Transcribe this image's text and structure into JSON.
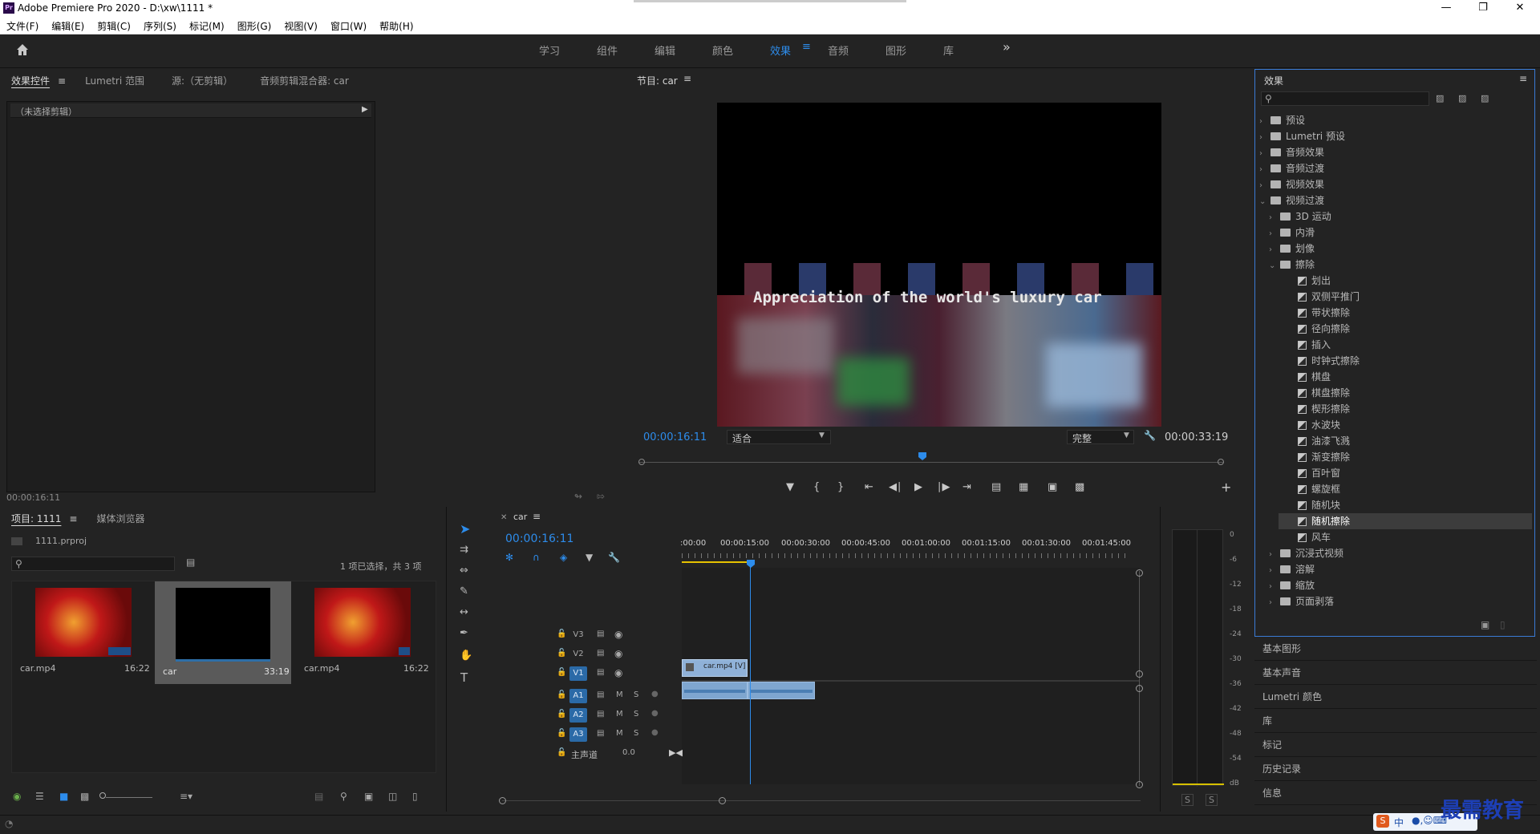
{
  "app": {
    "title": "Adobe Premiere Pro 2020 - D:\\xw\\1111 *",
    "logo_text": "Pr",
    "window_controls": [
      "minimize-icon",
      "maximize-icon",
      "close-icon"
    ]
  },
  "menu": [
    "文件(F)",
    "编辑(E)",
    "剪辑(C)",
    "序列(S)",
    "标记(M)",
    "图形(G)",
    "视图(V)",
    "窗口(W)",
    "帮助(H)"
  ],
  "workspaces": {
    "items": [
      "学习",
      "组件",
      "编辑",
      "颜色",
      "效果",
      "音频",
      "图形",
      "库"
    ],
    "active": "效果",
    "more": "»"
  },
  "source_panel": {
    "tabs": [
      "效果控件",
      "Lumetri 范围",
      "源:（无剪辑）",
      "音频剪辑混合器: car"
    ],
    "no_clip": "（未选择剪辑）",
    "timecode": "00:00:16:11"
  },
  "program": {
    "title": "节目: car",
    "overlay_text": "Appreciation of the world's luxury car",
    "timecode_current": "00:00:16:11",
    "fit": "适合",
    "quality": "完整",
    "timecode_total": "00:00:33:19",
    "playhead_fraction": 0.485
  },
  "project": {
    "tabs": [
      "项目: 1111",
      "媒体浏览器"
    ],
    "file": "1111.prproj",
    "selection": "1 项已选择，共 3 项",
    "items": [
      {
        "name": "car.mp4",
        "duration": "16:22",
        "kind": "video"
      },
      {
        "name": "car",
        "duration": "33:19",
        "kind": "sequence"
      },
      {
        "name": "car.mp4",
        "duration": "16:22",
        "kind": "video"
      }
    ]
  },
  "timeline": {
    "tab": "car",
    "timecode": "00:00:16:11",
    "ruler": [
      ":00:00",
      "00:00:15:00",
      "00:00:30:00",
      "00:00:45:00",
      "00:01:00:00",
      "00:01:15:00",
      "00:01:30:00",
      "00:01:45:00"
    ],
    "video_tracks": [
      "V3",
      "V2",
      "V1"
    ],
    "audio_tracks": [
      "A1",
      "A2",
      "A3"
    ],
    "master_label": "主声道",
    "master_value": "0.0",
    "clip_label": "car.mp4 [V]",
    "track_buttons": {
      "m": "M",
      "s": "S"
    }
  },
  "meter": {
    "scale": [
      "0",
      "-6",
      "-12",
      "-18",
      "-24",
      "-30",
      "-36",
      "-42",
      "-48",
      "-54",
      "dB"
    ],
    "solo": [
      "S",
      "S"
    ]
  },
  "effects": {
    "title": "效果",
    "tree": [
      {
        "label": "预设",
        "level": 0,
        "type": "folder",
        "expanded": false
      },
      {
        "label": "Lumetri 预设",
        "level": 0,
        "type": "folder",
        "expanded": false
      },
      {
        "label": "音频效果",
        "level": 0,
        "type": "folder",
        "expanded": false
      },
      {
        "label": "音频过渡",
        "level": 0,
        "type": "folder",
        "expanded": false
      },
      {
        "label": "视频效果",
        "level": 0,
        "type": "folder",
        "expanded": false
      },
      {
        "label": "视频过渡",
        "level": 0,
        "type": "folder",
        "expanded": true
      },
      {
        "label": "3D 运动",
        "level": 1,
        "type": "folder",
        "expanded": false
      },
      {
        "label": "内滑",
        "level": 1,
        "type": "folder",
        "expanded": false
      },
      {
        "label": "划像",
        "level": 1,
        "type": "folder",
        "expanded": false
      },
      {
        "label": "擦除",
        "level": 1,
        "type": "folder",
        "expanded": true
      },
      {
        "label": "划出",
        "level": 2,
        "type": "fx"
      },
      {
        "label": "双侧平推门",
        "level": 2,
        "type": "fx"
      },
      {
        "label": "带状擦除",
        "level": 2,
        "type": "fx"
      },
      {
        "label": "径向擦除",
        "level": 2,
        "type": "fx"
      },
      {
        "label": "插入",
        "level": 2,
        "type": "fx"
      },
      {
        "label": "时钟式擦除",
        "level": 2,
        "type": "fx"
      },
      {
        "label": "棋盘",
        "level": 2,
        "type": "fx"
      },
      {
        "label": "棋盘擦除",
        "level": 2,
        "type": "fx"
      },
      {
        "label": "楔形擦除",
        "level": 2,
        "type": "fx"
      },
      {
        "label": "水波块",
        "level": 2,
        "type": "fx"
      },
      {
        "label": "油漆飞溅",
        "level": 2,
        "type": "fx"
      },
      {
        "label": "渐变擦除",
        "level": 2,
        "type": "fx"
      },
      {
        "label": "百叶窗",
        "level": 2,
        "type": "fx"
      },
      {
        "label": "螺旋框",
        "level": 2,
        "type": "fx"
      },
      {
        "label": "随机块",
        "level": 2,
        "type": "fx"
      },
      {
        "label": "随机擦除",
        "level": 2,
        "type": "fx",
        "selected": true
      },
      {
        "label": "风车",
        "level": 2,
        "type": "fx"
      },
      {
        "label": "沉浸式视频",
        "level": 1,
        "type": "folder",
        "expanded": false
      },
      {
        "label": "溶解",
        "level": 1,
        "type": "folder",
        "expanded": false
      },
      {
        "label": "缩放",
        "level": 1,
        "type": "folder",
        "expanded": false
      },
      {
        "label": "页面剥落",
        "level": 1,
        "type": "folder",
        "expanded": false
      }
    ],
    "lower_panels": [
      "基本图形",
      "基本声音",
      "Lumetri 颜色",
      "库",
      "标记",
      "历史记录",
      "信息"
    ]
  },
  "watermark": "最需教育",
  "ime": "中",
  "colors": {
    "accent": "#2d8ceb",
    "panel": "#1e1e1e",
    "bg": "#232323",
    "clip_video": "#8fb1d8",
    "clip_audio": "#7fa6cf",
    "track_on": "#2b6aa7"
  }
}
